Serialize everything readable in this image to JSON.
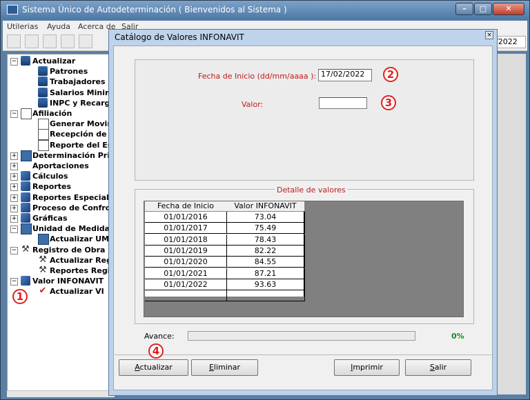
{
  "app": {
    "title": "Sistema Único de Autodeterminación ( Bienvenidos al Sistema )",
    "menu": [
      "Utilerias",
      "Ayuda",
      "Acerca de",
      "Salir"
    ],
    "date_fragment": "/2022"
  },
  "tree": {
    "items": [
      {
        "label": "Actualizar",
        "level": 0,
        "exp": "-",
        "icon": "people-icon"
      },
      {
        "label": "Patrones",
        "level": 1,
        "icon": "person-icon"
      },
      {
        "label": "Trabajadores",
        "level": 1,
        "icon": "person-icon"
      },
      {
        "label": "Salarios Minimo",
        "level": 1,
        "icon": "person-icon"
      },
      {
        "label": "INPC y Recargos",
        "level": 1,
        "icon": "person-icon"
      },
      {
        "label": "Afiliación",
        "level": 0,
        "exp": "-",
        "icon": "document-icon"
      },
      {
        "label": "Generar Movimi",
        "level": 1,
        "icon": "document-icon"
      },
      {
        "label": "Recepción de M",
        "level": 1,
        "icon": "document-icon"
      },
      {
        "label": "Reporte del Esta",
        "level": 1,
        "icon": "document-icon"
      },
      {
        "label": "Determinación Prim",
        "level": 0,
        "exp": "+",
        "icon": "calculator-icon"
      },
      {
        "label": "Aportaciones",
        "level": 0,
        "exp": "+",
        "icon": ""
      },
      {
        "label": "Cálculos",
        "level": 0,
        "exp": "+",
        "icon": "sigma-icon"
      },
      {
        "label": "Reportes",
        "level": 0,
        "exp": "+",
        "icon": "reports-icon"
      },
      {
        "label": "Reportes Especiales",
        "level": 0,
        "exp": "+",
        "icon": "printer-icon"
      },
      {
        "label": "Proceso de Confron",
        "level": 0,
        "exp": "+",
        "icon": "sync-icon"
      },
      {
        "label": "Gráficas",
        "level": 0,
        "exp": "+",
        "icon": "chart-icon"
      },
      {
        "label": "Unidad de Medida y",
        "level": 0,
        "exp": "-",
        "icon": "calculator-icon"
      },
      {
        "label": "Actualizar UMA",
        "level": 1,
        "icon": "calculator-icon"
      },
      {
        "label": "Registro de Obra",
        "level": 0,
        "exp": "-",
        "icon": "tools-icon"
      },
      {
        "label": "Actualizar Regis",
        "level": 1,
        "icon": "tools-icon"
      },
      {
        "label": "Reportes Regist",
        "level": 1,
        "icon": "tools-icon"
      },
      {
        "label": "Valor INFONAVIT",
        "level": 0,
        "exp": "-",
        "icon": "coin-icon"
      },
      {
        "label": "Actualizar VI",
        "level": 1,
        "icon": "checkmark-icon"
      }
    ]
  },
  "dialog": {
    "title": "Catálogo de Valores INFONAVIT",
    "fecha_label": "Fecha de Inicio (dd/mm/aaaa ):",
    "fecha_value": "17/02/2022",
    "valor_label": "Valor:",
    "valor_value": "",
    "detail_title": "Detalle de valores",
    "table": {
      "headers": [
        "Fecha de Inicio",
        "Valor INFONAVIT"
      ],
      "rows": [
        [
          "01/01/2016",
          "73.04"
        ],
        [
          "01/01/2017",
          "75.49"
        ],
        [
          "01/01/2018",
          "78.43"
        ],
        [
          "01/01/2019",
          "82.22"
        ],
        [
          "01/01/2020",
          "84.55"
        ],
        [
          "01/01/2021",
          "87.21"
        ],
        [
          "01/01/2022",
          "93.63"
        ]
      ]
    },
    "avance_label": "Avance:",
    "progress_percent": 0,
    "progress_text": "0%",
    "buttons": {
      "actualizar": {
        "hot": "A",
        "rest": "ctualizar"
      },
      "eliminar": {
        "hot": "E",
        "rest": "liminar"
      },
      "imprimir": {
        "hot": "I",
        "rest": "mprimir"
      },
      "salir": {
        "hot": "S",
        "rest": "alir"
      }
    }
  },
  "annotations": [
    "1",
    "2",
    "3",
    "4"
  ],
  "colors": {
    "label_red": "#c01818",
    "badge_red": "#e0201a",
    "percent_green": "#1a8a1a"
  }
}
